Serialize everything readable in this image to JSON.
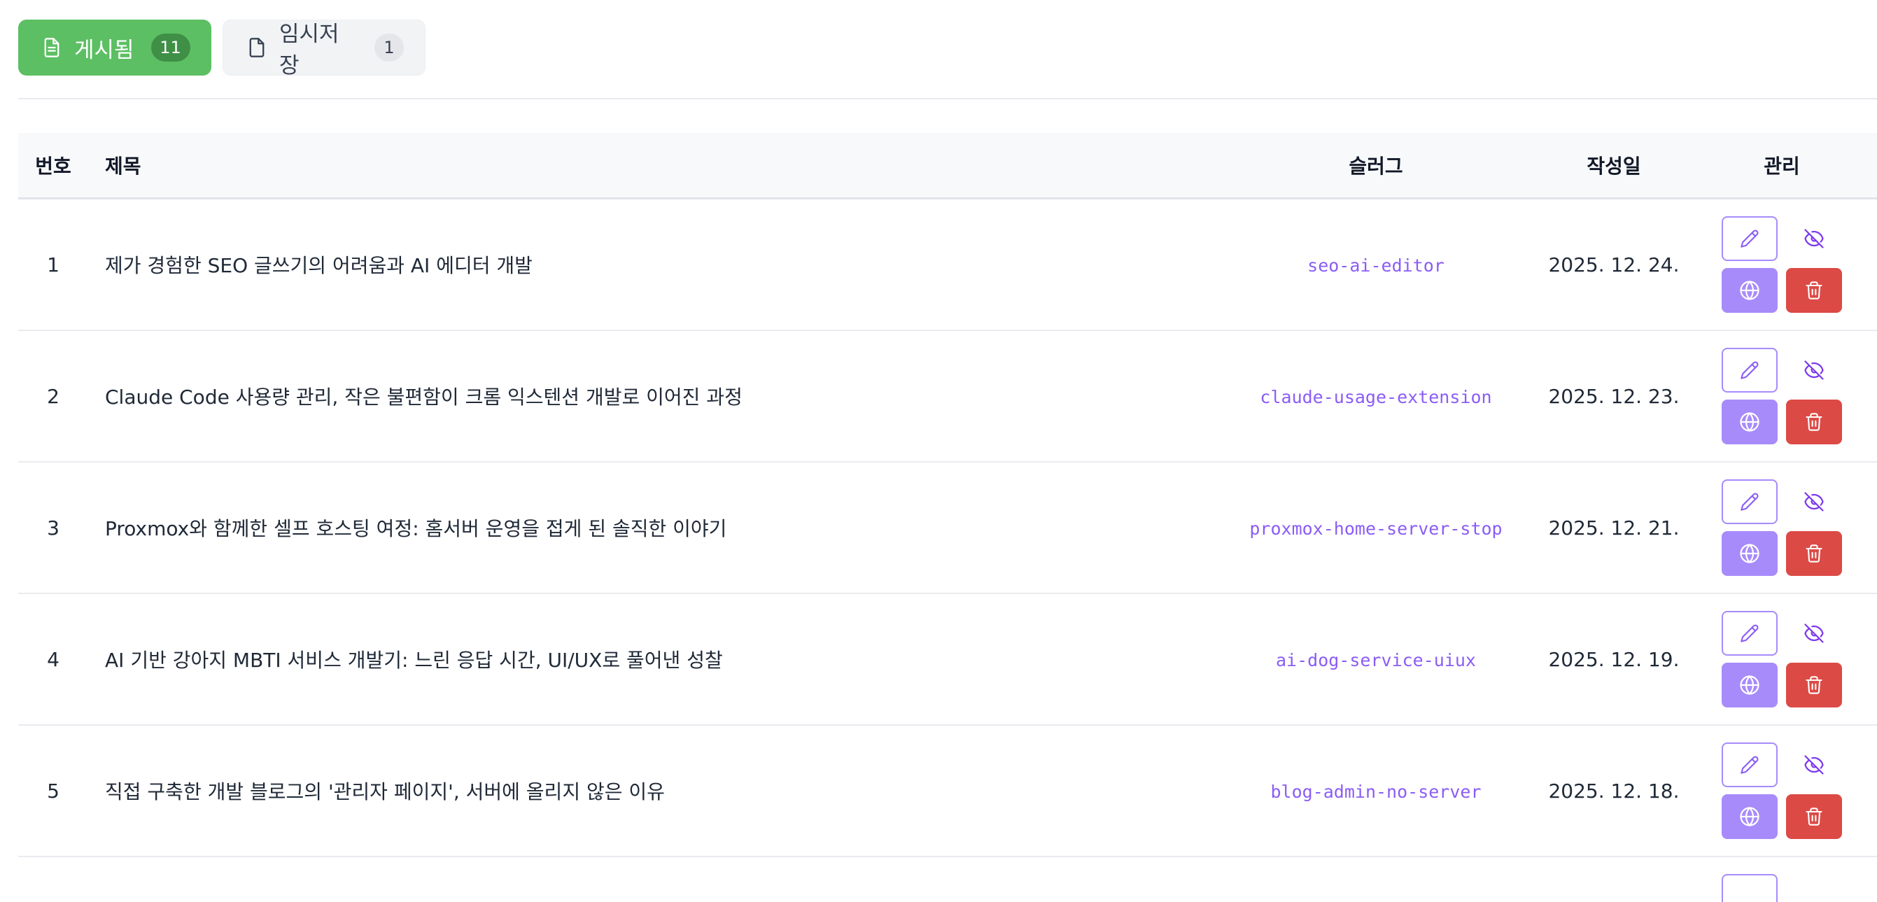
{
  "tabs": {
    "published": {
      "label": "게시됨",
      "count": "11",
      "icon": "document-text-icon",
      "color": "#5cbf63"
    },
    "draft": {
      "label": "임시저장",
      "count": "1",
      "icon": "document-icon"
    }
  },
  "table": {
    "headers": {
      "num": "번호",
      "title": "제목",
      "slug": "슬러그",
      "date": "작성일",
      "manage": "관리"
    },
    "rows": [
      {
        "num": "1",
        "title": "제가 경험한 SEO 글쓰기의 어려움과 AI 에디터 개발",
        "slug": "seo-ai-editor",
        "date": "2025. 12. 24."
      },
      {
        "num": "2",
        "title": "Claude Code 사용량 관리, 작은 불편함이 크롬 익스텐션 개발로 이어진 과정",
        "slug": "claude-usage-extension",
        "date": "2025. 12. 23."
      },
      {
        "num": "3",
        "title": "Proxmox와 함께한 셀프 호스팅 여정: 홈서버 운영을 접게 된 솔직한 이야기",
        "slug": "proxmox-home-server-stop",
        "date": "2025. 12. 21."
      },
      {
        "num": "4",
        "title": "AI 기반 강아지 MBTI 서비스 개발기: 느린 응답 시간, UI/UX로 풀어낸 성찰",
        "slug": "ai-dog-service-uiux",
        "date": "2025. 12. 19."
      },
      {
        "num": "5",
        "title": "직접 구축한 개발 블로그의 '관리자 페이지', 서버에 올리지 않은 이유",
        "slug": "blog-admin-no-server",
        "date": "2025. 12. 18."
      }
    ],
    "actions": {
      "edit_icon": "pencil-icon",
      "hide_icon": "eye-off-icon",
      "publish_icon": "globe-icon",
      "delete_icon": "trash-icon"
    }
  },
  "colors": {
    "accent_purple": "#a78bfa",
    "slug_purple": "#8b5cf6",
    "danger_red": "#dc4a46"
  }
}
